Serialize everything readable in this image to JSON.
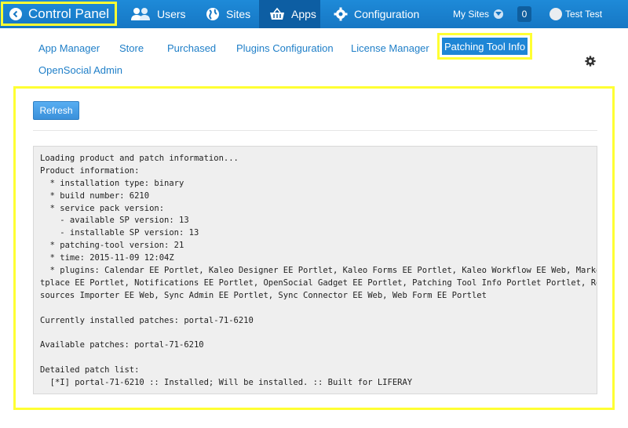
{
  "dock": {
    "control_panel": "Control Panel",
    "nav": [
      {
        "label": "Users",
        "icon": "users-icon"
      },
      {
        "label": "Sites",
        "icon": "globe-icon"
      },
      {
        "label": "Apps",
        "icon": "basket-icon",
        "active": true
      },
      {
        "label": "Configuration",
        "icon": "gear-icon"
      }
    ],
    "my_sites": "My Sites",
    "notification_count": "0",
    "user_name": "Test Test"
  },
  "tabs": {
    "items": [
      "App Manager",
      "Store",
      "Purchased",
      "Plugins Configuration",
      "License Manager"
    ],
    "active": "Patching Tool Info",
    "second_row": "OpenSocial Admin"
  },
  "panel": {
    "refresh_label": "Refresh",
    "console_lines": [
      "Loading product and patch information...",
      "Product information:",
      "  * installation type: binary",
      "  * build number: 6210",
      "  * service pack version:",
      "    - available SP version: 13",
      "    - installable SP version: 13",
      "  * patching-tool version: 21",
      "  * time: 2015-11-09 12:04Z",
      "  * plugins: Calendar EE Portlet, Kaleo Designer EE Portlet, Kaleo Forms EE Portlet, Kaleo Workflow EE Web, Marke",
      "tplace EE Portlet, Notifications EE Portlet, OpenSocial Gadget EE Portlet, Patching Tool Info Portlet Portlet, Re",
      "sources Importer EE Web, Sync Admin EE Portlet, Sync Connector EE Web, Web Form EE Portlet",
      "",
      "Currently installed patches: portal-71-6210",
      "",
      "Available patches: portal-71-6210",
      "",
      "Detailed patch list:",
      "  [*I] portal-71-6210 :: Installed; Will be installed. :: Built for LIFERAY"
    ]
  },
  "colors": {
    "dock_blue": "#1677c4",
    "active_blue": "#0d5ea3",
    "link_blue": "#1f7fc8",
    "highlight_yellow": "#ffff33"
  }
}
